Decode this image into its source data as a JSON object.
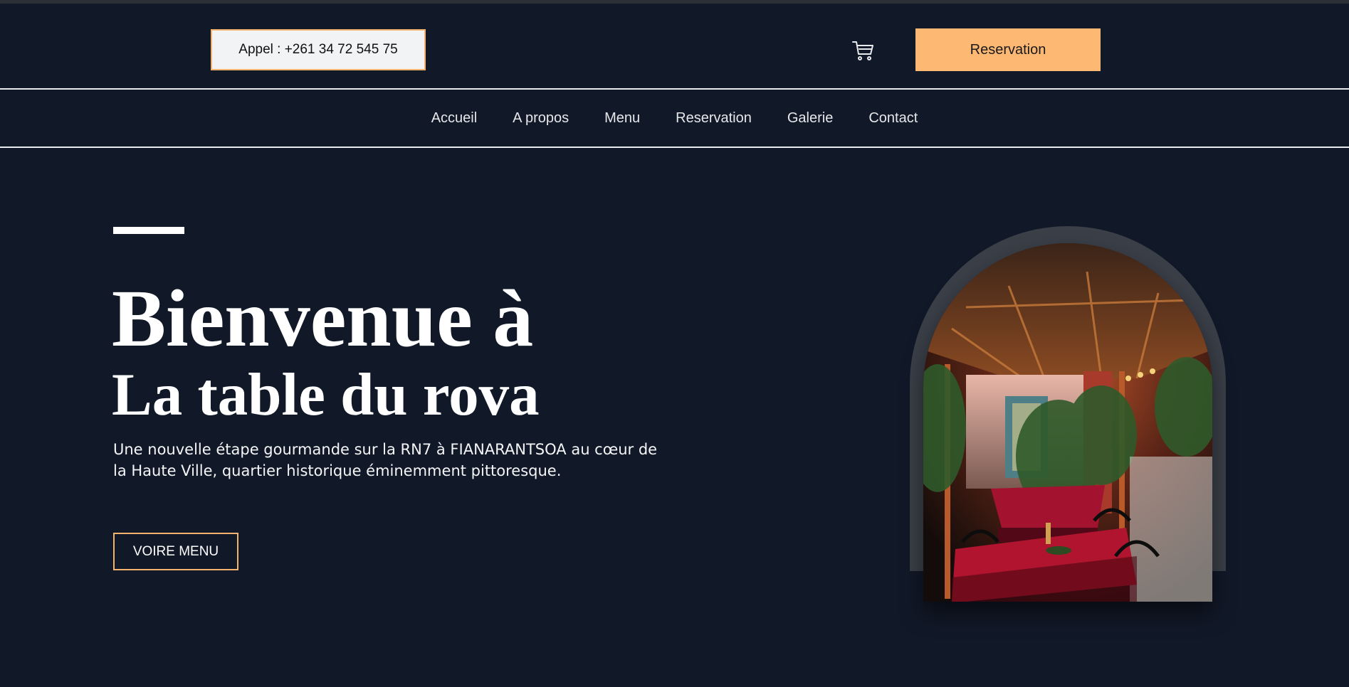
{
  "header": {
    "call_label": "Appel : +261 34 72 545 75",
    "cart_icon": "cart-icon",
    "reserve_label": "Reservation"
  },
  "nav": {
    "items": [
      {
        "label": "Accueil"
      },
      {
        "label": "A propos"
      },
      {
        "label": "Menu"
      },
      {
        "label": "Reservation"
      },
      {
        "label": "Galerie"
      },
      {
        "label": "Contact"
      }
    ]
  },
  "hero": {
    "title_line1": "Bienvenue à",
    "title_line2": "La table du rova",
    "description": "Une nouvelle étape gourmande sur la RN7 à FIANARANTSOA au cœur de la Haute Ville, quartier historique éminemment pittoresque.",
    "cta_label": "VOIRE MENU"
  },
  "colors": {
    "background": "#111827",
    "accent": "#fdb874",
    "border_accent": "#f4b36c",
    "arch_frame": "#3a3f48"
  }
}
